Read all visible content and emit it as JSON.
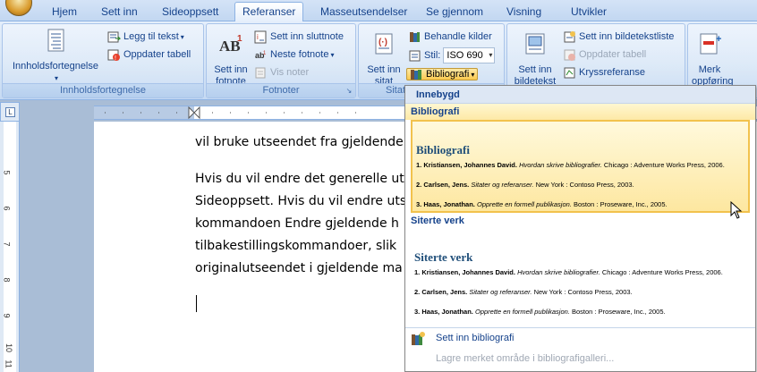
{
  "tabs": [
    "Hjem",
    "Sett inn",
    "Sideoppsett",
    "Referanser",
    "Masseutsendelser",
    "Se gjennom",
    "Visning",
    "Utvikler"
  ],
  "active_tab": "Referanser",
  "ribbon": {
    "toc_group": {
      "label": "Innholdsfortegnelse",
      "big_button": "Innholdsfortegnelse",
      "add_text": "Legg til tekst",
      "update_table": "Oppdater tabell"
    },
    "footnotes_group": {
      "label": "Fotnoter",
      "insert_footnote_line1": "Sett inn",
      "insert_footnote_line2": "fotnote",
      "insert_endnote": "Sett inn sluttnote",
      "next_footnote": "Neste fotnote",
      "show_notes": "Vis noter"
    },
    "citations_group": {
      "label": "Sitat",
      "insert_citation_line1": "Sett inn",
      "insert_citation_line2": "sitat",
      "manage_sources": "Behandle kilder",
      "style_label": "Stil:",
      "style_value": "ISO 690",
      "bibliography": "Bibliografi"
    },
    "captions_group": {
      "insert_caption_line1": "Sett inn",
      "insert_caption_line2": "bildetekst",
      "insert_table_of_figures": "Sett inn bildetekstliste",
      "update_table": "Oppdater tabell",
      "cross_reference": "Kryssreferanse"
    },
    "index_group": {
      "mark_entry_line1": "Merk",
      "mark_entry_line2": "oppføring"
    }
  },
  "document": {
    "lines": [
      "vil bruke utseendet fra gjeldende",
      "Hvis du vil endre det generelle ut",
      "Sideoppsett. Hvis du vil endre uts",
      "kommandoen Endre gjeldende h",
      "tilbakestillingskommandoer, slik",
      "originalutseendet i gjeldende ma"
    ]
  },
  "vruler_numbers": [
    "5",
    "6",
    "7",
    "8",
    "9",
    "10",
    "11"
  ],
  "gallery": {
    "header": "Innebygd",
    "items": [
      {
        "label": "Bibliografi",
        "preview_title": "Bibliografi",
        "highlighted": true,
        "refs": [
          {
            "num": "1.",
            "author": "Kristiansen, Johannes David.",
            "title": "Hvordan skrive bibliografier.",
            "rest": "Chicago : Adventure Works Press, 2006."
          },
          {
            "num": "2.",
            "author": "Carlsen, Jens.",
            "title": "Sitater og referanser.",
            "rest": "New York : Contoso Press, 2003."
          },
          {
            "num": "3.",
            "author": "Haas, Jonathan.",
            "title": "Opprette en formell publikasjon.",
            "rest": "Boston : Proseware, Inc., 2005."
          }
        ]
      },
      {
        "label": "Siterte verk",
        "preview_title": "Siterte verk",
        "highlighted": false,
        "refs": [
          {
            "num": "1.",
            "author": "Kristiansen, Johannes David.",
            "title": "Hvordan skrive bibliografier.",
            "rest": "Chicago : Adventure Works Press, 2006."
          },
          {
            "num": "2.",
            "author": "Carlsen, Jens.",
            "title": "Sitater og referanser.",
            "rest": "New York : Contoso Press, 2003."
          },
          {
            "num": "3.",
            "author": "Haas, Jonathan.",
            "title": "Opprette en formell publikasjon.",
            "rest": "Boston : Proseware, Inc., 2005."
          }
        ]
      }
    ],
    "insert_bibliography": "Sett inn bibliografi",
    "save_selection": "Lagre merket område i bibliografigalleri..."
  }
}
